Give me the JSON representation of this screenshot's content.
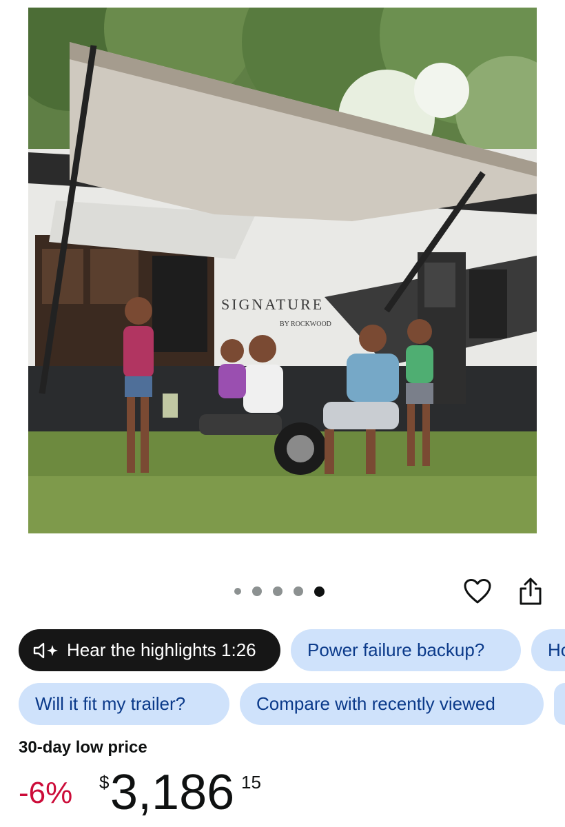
{
  "product": {
    "image_alt": "Family sitting under the extended awning of a travel trailer",
    "rv_brand_text": "SIGNATURE",
    "rv_subbrand_text": "BY ROCKWOOD"
  },
  "carousel": {
    "dot_count": 5,
    "active_index": 4
  },
  "actions": {
    "favorite_icon": "heart-icon",
    "share_icon": "share-icon"
  },
  "chips": [
    {
      "label": "Hear the highlights 1:26",
      "icon": "audio-sparkle-icon",
      "style": "dark"
    },
    {
      "label": "Power failure backup?"
    },
    {
      "label": "Ho"
    },
    {
      "label": "Will it fit my trailer?"
    },
    {
      "label": "Compare with recently viewed"
    }
  ],
  "price": {
    "label": "30-day low price",
    "discount": "-6%",
    "currency": "$",
    "whole": "3,186",
    "fraction": "15"
  },
  "colors": {
    "chip_bg": "#cfe2fb",
    "chip_text": "#0b3a8a",
    "dark_chip_bg": "#161616",
    "discount_red": "#cc0c39"
  }
}
